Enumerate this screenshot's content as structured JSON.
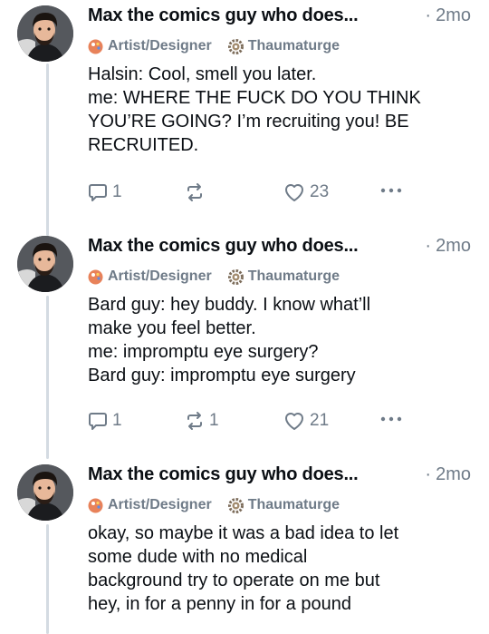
{
  "posts": [
    {
      "author": "Max the comics guy who does...",
      "time": "2mo",
      "badges": [
        "Artist/Designer",
        "Thaumaturge"
      ],
      "lines": [
        "Halsin: Cool, smell you later.",
        "me: WHERE THE FUCK DO YOU THINK",
        "YOU’RE GOING? I’m recruiting you! BE",
        "RECRUITED."
      ],
      "replies": "1",
      "reposts": "",
      "likes": "23"
    },
    {
      "author": "Max the comics guy who does...",
      "time": "2mo",
      "badges": [
        "Artist/Designer",
        "Thaumaturge"
      ],
      "lines": [
        "Bard guy: hey buddy. I know what’ll",
        "make you feel better.",
        "me: impromptu eye surgery?",
        "Bard guy:  impromptu eye surgery"
      ],
      "replies": "1",
      "reposts": "1",
      "likes": "21"
    },
    {
      "author": "Max the comics guy who does...",
      "time": "2mo",
      "badges": [
        "Artist/Designer",
        "Thaumaturge"
      ],
      "lines": [
        "okay, so maybe it was a bad idea to let",
        "some dude with no medical",
        "background try to operate on me but",
        "hey, in for a penny in for a pound"
      ],
      "replies": "",
      "reposts": "",
      "likes": ""
    }
  ],
  "icons": {
    "reply": "reply-icon",
    "repost": "repost-icon",
    "like": "heart-icon",
    "more": "more-options-icon",
    "badge_artist": "palette-icon",
    "badge_thaumaturge": "gear-icon"
  },
  "colors": {
    "text": "#0b0f14",
    "muted": "#6f7b88",
    "thread_line": "#d4dbe2",
    "artist_badge": "#e0784a"
  }
}
